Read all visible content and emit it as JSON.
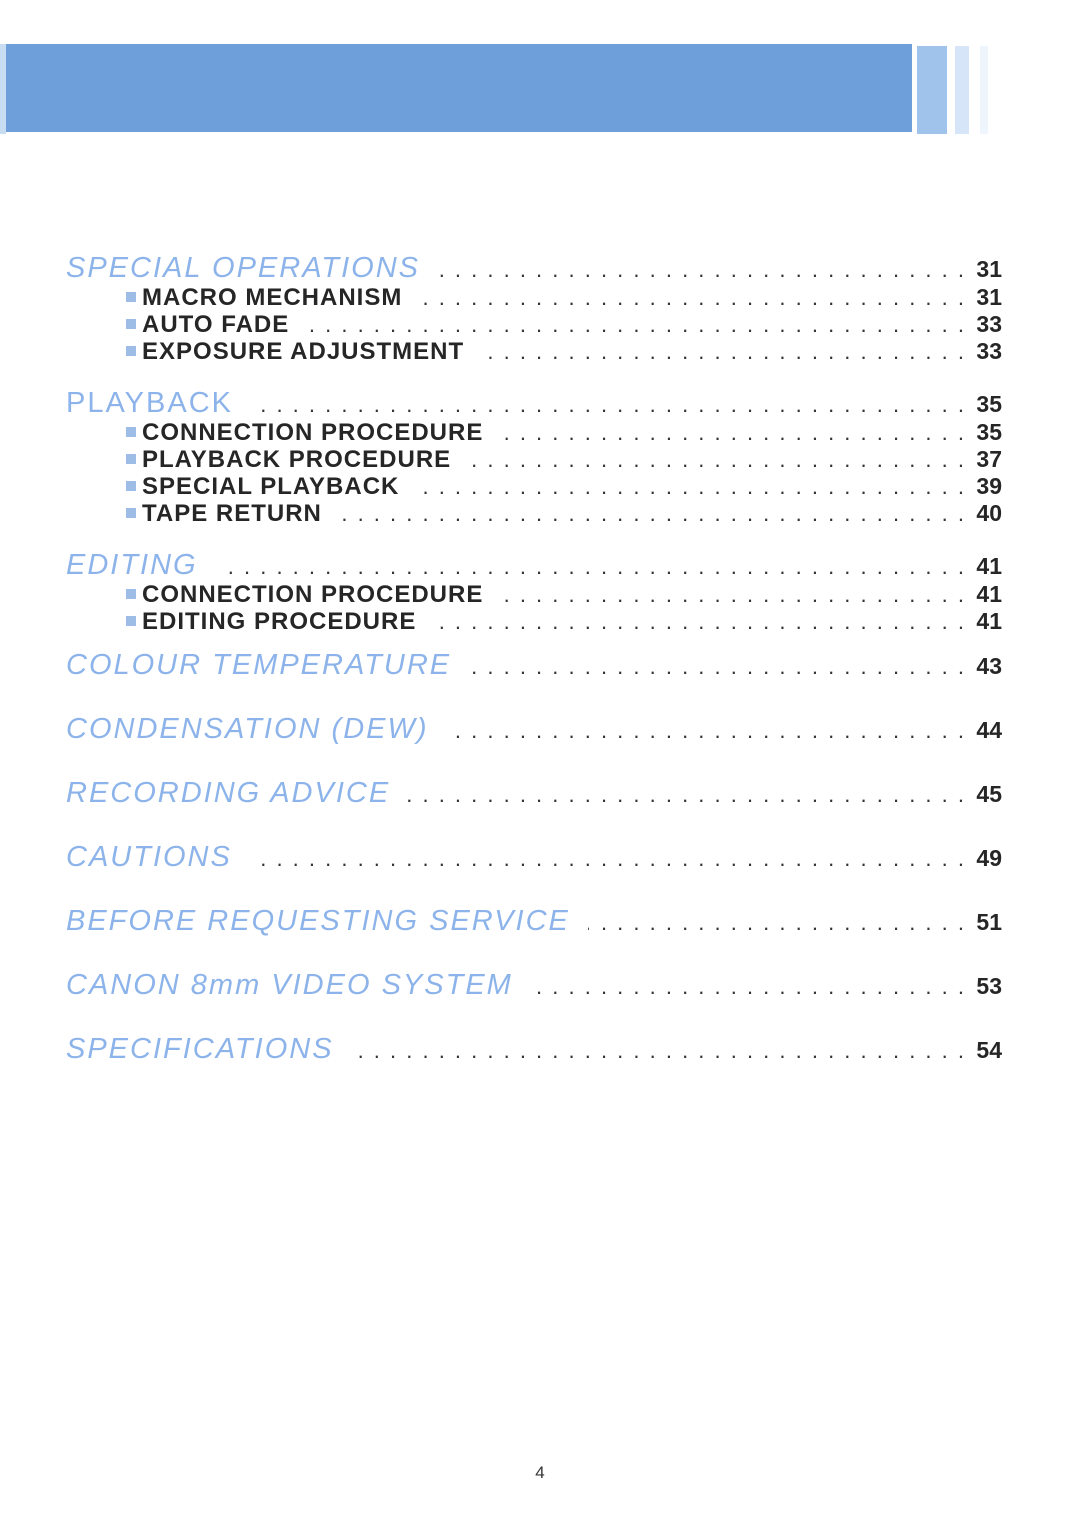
{
  "colors": {
    "banner": "#6f9fdb",
    "heading": "#8cb3ea",
    "text": "#262626"
  },
  "toc": [
    {
      "title": "SPECIAL OPERATIONS",
      "page": "31",
      "italic": true,
      "items": [
        {
          "label": "MACRO MECHANISM",
          "page": "31"
        },
        {
          "label": "AUTO FADE",
          "page": "33"
        },
        {
          "label": "EXPOSURE ADJUSTMENT",
          "page": "33"
        }
      ]
    },
    {
      "title": "PLAYBACK",
      "page": "35",
      "italic": false,
      "items": [
        {
          "label": "CONNECTION PROCEDURE",
          "page": "35"
        },
        {
          "label": "PLAYBACK PROCEDURE",
          "page": "37"
        },
        {
          "label": "SPECIAL PLAYBACK",
          "page": "39"
        },
        {
          "label": "TAPE RETURN",
          "page": "40"
        }
      ]
    },
    {
      "title": "EDITING",
      "page": "41",
      "italic": true,
      "items": [
        {
          "label": "CONNECTION PROCEDURE",
          "page": "41"
        },
        {
          "label": "EDITING PROCEDURE",
          "page": "41"
        }
      ]
    },
    {
      "title": "COLOUR TEMPERATURE",
      "page": "43",
      "italic": true,
      "items": []
    },
    {
      "title": "CONDENSATION (DEW)",
      "page": "44",
      "italic": true,
      "items": []
    },
    {
      "title": "RECORDING ADVICE",
      "page": "45",
      "italic": true,
      "items": []
    },
    {
      "title": "CAUTIONS",
      "page": "49",
      "italic": true,
      "items": []
    },
    {
      "title": "BEFORE REQUESTING SERVICE",
      "page": "51",
      "italic": true,
      "items": []
    },
    {
      "title": "CANON 8mm VIDEO SYSTEM",
      "page": "53",
      "italic": true,
      "items": []
    },
    {
      "title": "SPECIFICATIONS",
      "page": "54",
      "italic": true,
      "items": []
    }
  ],
  "footer": {
    "page_number": "4"
  }
}
